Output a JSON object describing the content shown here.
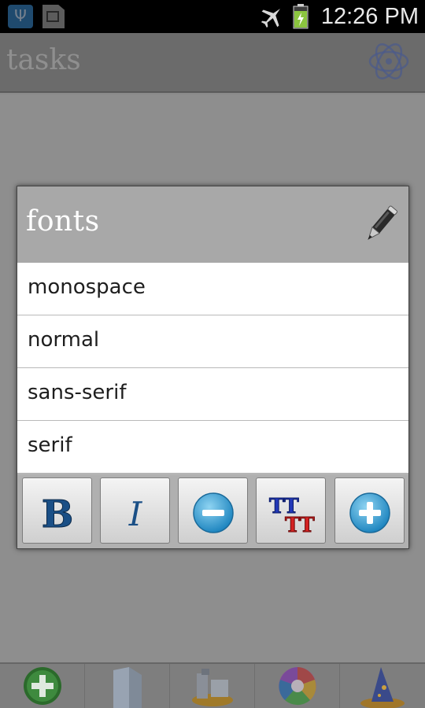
{
  "status_bar": {
    "time": "12:26 PM",
    "usb_glyph": "Ψ",
    "icons": [
      "usb-icon",
      "sd-card-icon",
      "airplane-icon",
      "battery-charging-icon"
    ]
  },
  "app_header": {
    "title": "tasks",
    "logo_icon": "atom-logo-icon"
  },
  "dialog": {
    "title": "fonts",
    "title_icon": "pen-icon",
    "items": [
      {
        "label": "monospace"
      },
      {
        "label": "normal"
      },
      {
        "label": "sans-serif"
      },
      {
        "label": "serif"
      }
    ],
    "toolbar": [
      {
        "icon": "bold-icon",
        "glyph": "B",
        "color": "#1a4f86"
      },
      {
        "icon": "italic-icon",
        "glyph": "I",
        "color": "#1a4f86"
      },
      {
        "icon": "minus-circle-icon",
        "color": "#2f9fd6"
      },
      {
        "icon": "font-size-icon",
        "glyph": "TT",
        "colors": [
          "#2238b8",
          "#d42222"
        ]
      },
      {
        "icon": "plus-circle-icon",
        "color": "#2f9fd6"
      }
    ]
  },
  "bottom_bar": {
    "items": [
      {
        "icon": "add-green-icon"
      },
      {
        "icon": "document-icon"
      },
      {
        "icon": "tools-icon"
      },
      {
        "icon": "color-wheel-icon"
      },
      {
        "icon": "wizard-hat-icon"
      }
    ]
  }
}
